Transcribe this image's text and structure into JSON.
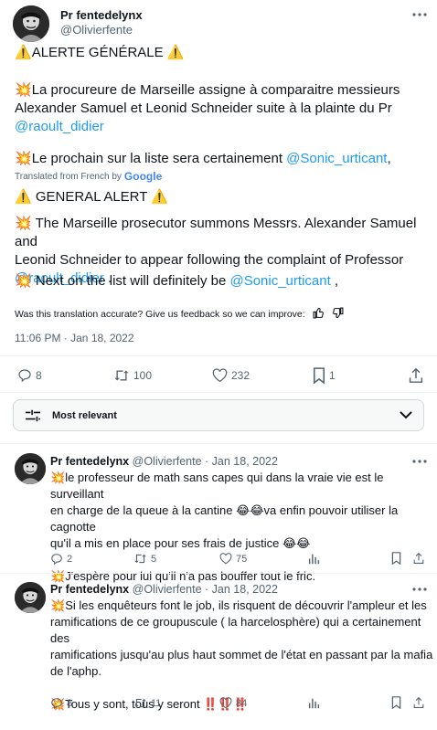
{
  "tweet": {
    "author_name": "Pr fentedelynx",
    "author_handle": "@Olivierfente",
    "alert_title": "ALERTE GÉNÉRALE",
    "fr_line1": "La procureure de Marseille assigne à comparaitre messieurs",
    "fr_line2": "Alexander Samuel et Leonid Schneider suite à la plainte du Pr",
    "fr_mention1": "@raoult_didier",
    "fr_line3_prefix": "Le prochain sur la liste sera certainement ",
    "fr_mention2": "@Sonic_urticant",
    "fr_line3_suffix": ",",
    "translated_prefix": "Translated from French by",
    "translated_brand": "Google",
    "en_alert_title": "GENERAL ALERT",
    "en_line1": "The Marseille prosecutor summons Messrs. Alexander Samuel and",
    "en_line2": "Leonid Schneider to appear following the complaint of Professor",
    "en_mention1": "@raoult_didier",
    "en_line2_suffix": " .",
    "en_line3_prefix": "Next on the list will definitely be ",
    "en_mention2": "@Sonic_urticant",
    "en_line3_suffix": " ,",
    "feedback_question": "Was this translation accurate? Give us feedback so we can improve:",
    "timestamp": "11:06 PM · Jan 18, 2022",
    "stats": {
      "replies": "8",
      "retweets": "100",
      "likes": "232",
      "bookmarks": "1"
    }
  },
  "sort": {
    "label": "Most relevant"
  },
  "replies": [
    {
      "author_name": "Pr fentedelynx",
      "author_handle": "@Olivierfente",
      "date": "· Jan 18, 2022",
      "line1": "le professeur de math sans capes qui dans la vraie vie est le surveillant",
      "line2_prefix": "en charge de la queue à la cantine ",
      "line2_suffix": "va enfin pouvoir utiliser la cagnotte",
      "line3": "qu'il a mis en place pour ses frais de justice ",
      "line4": "J'espère pour lui qu'il n'a pas bouffer tout le fric.",
      "replies": "2",
      "retweets": "5",
      "likes": "75"
    },
    {
      "author_name": "Pr fentedelynx",
      "author_handle": "@Olivierfente",
      "date": "· Jan 18, 2022",
      "line1": "Si les enquêteurs font le job, ils risquent de découvrir l'ampleur et les",
      "line2": "ramifications de ce groupuscule ( la harcelosphère) qui a certainement des",
      "line3": "ramifications jusqu'au plus haut sommet de l'état en passant par la mafia",
      "line4": "de l'aphp.",
      "line5": "Tous y sont, tous y seront ",
      "replies": "8",
      "retweets": "11",
      "likes": "84"
    }
  ],
  "icons": {
    "warning": "⚠️",
    "collision": "💥",
    "laugh": "😂",
    "double_exclaim": "‼️"
  }
}
